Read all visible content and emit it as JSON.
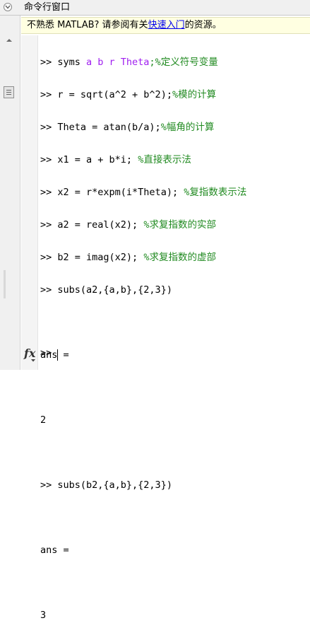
{
  "window": {
    "title": "命令行窗口"
  },
  "infobar": {
    "prefix": "不熟悉 MATLAB? 请参阅有关",
    "link": "快速入门",
    "suffix": "的资源。"
  },
  "commands": [
    {
      "prompt": ">> ",
      "code": "syms ",
      "syms_vars": "a b r Theta",
      "comment": ";%定义符号变量"
    },
    {
      "prompt": ">> ",
      "code": "r = sqrt(a^2 + b^2);",
      "comment": "%模的计算"
    },
    {
      "prompt": ">> ",
      "code": "Theta = atan(b/a);",
      "comment": "%幅角的计算"
    },
    {
      "prompt": ">> ",
      "code": "x1 = a + b*i; ",
      "comment": "%直接表示法"
    },
    {
      "prompt": ">> ",
      "code": "x2 = r*expm(i*Theta); ",
      "comment": "%复指数表示法"
    },
    {
      "prompt": ">> ",
      "code": "a2 = real(x2); ",
      "comment": "%求复指数的实部"
    },
    {
      "prompt": ">> ",
      "code": "b2 = imag(x2); ",
      "comment": "%求复指数的虚部"
    },
    {
      "prompt": ">> ",
      "code": "subs(a2,{a,b},{2,3})"
    }
  ],
  "output1": {
    "label": "ans =",
    "value": "2"
  },
  "command2": {
    "prompt": ">> ",
    "code": "subs(b2,{a,b},{2,3})"
  },
  "output2": {
    "label": "ans =",
    "value": "3"
  },
  "current_prompt": ">>",
  "icons": {
    "fx": "fx",
    "collapse": "chevron-down-icon",
    "scroll_up": "scroll-up-icon"
  },
  "colors": {
    "keyword": "#a020f0",
    "comment": "#228b22",
    "infobar_bg": "#ffffe1",
    "link": "#0000ee"
  }
}
